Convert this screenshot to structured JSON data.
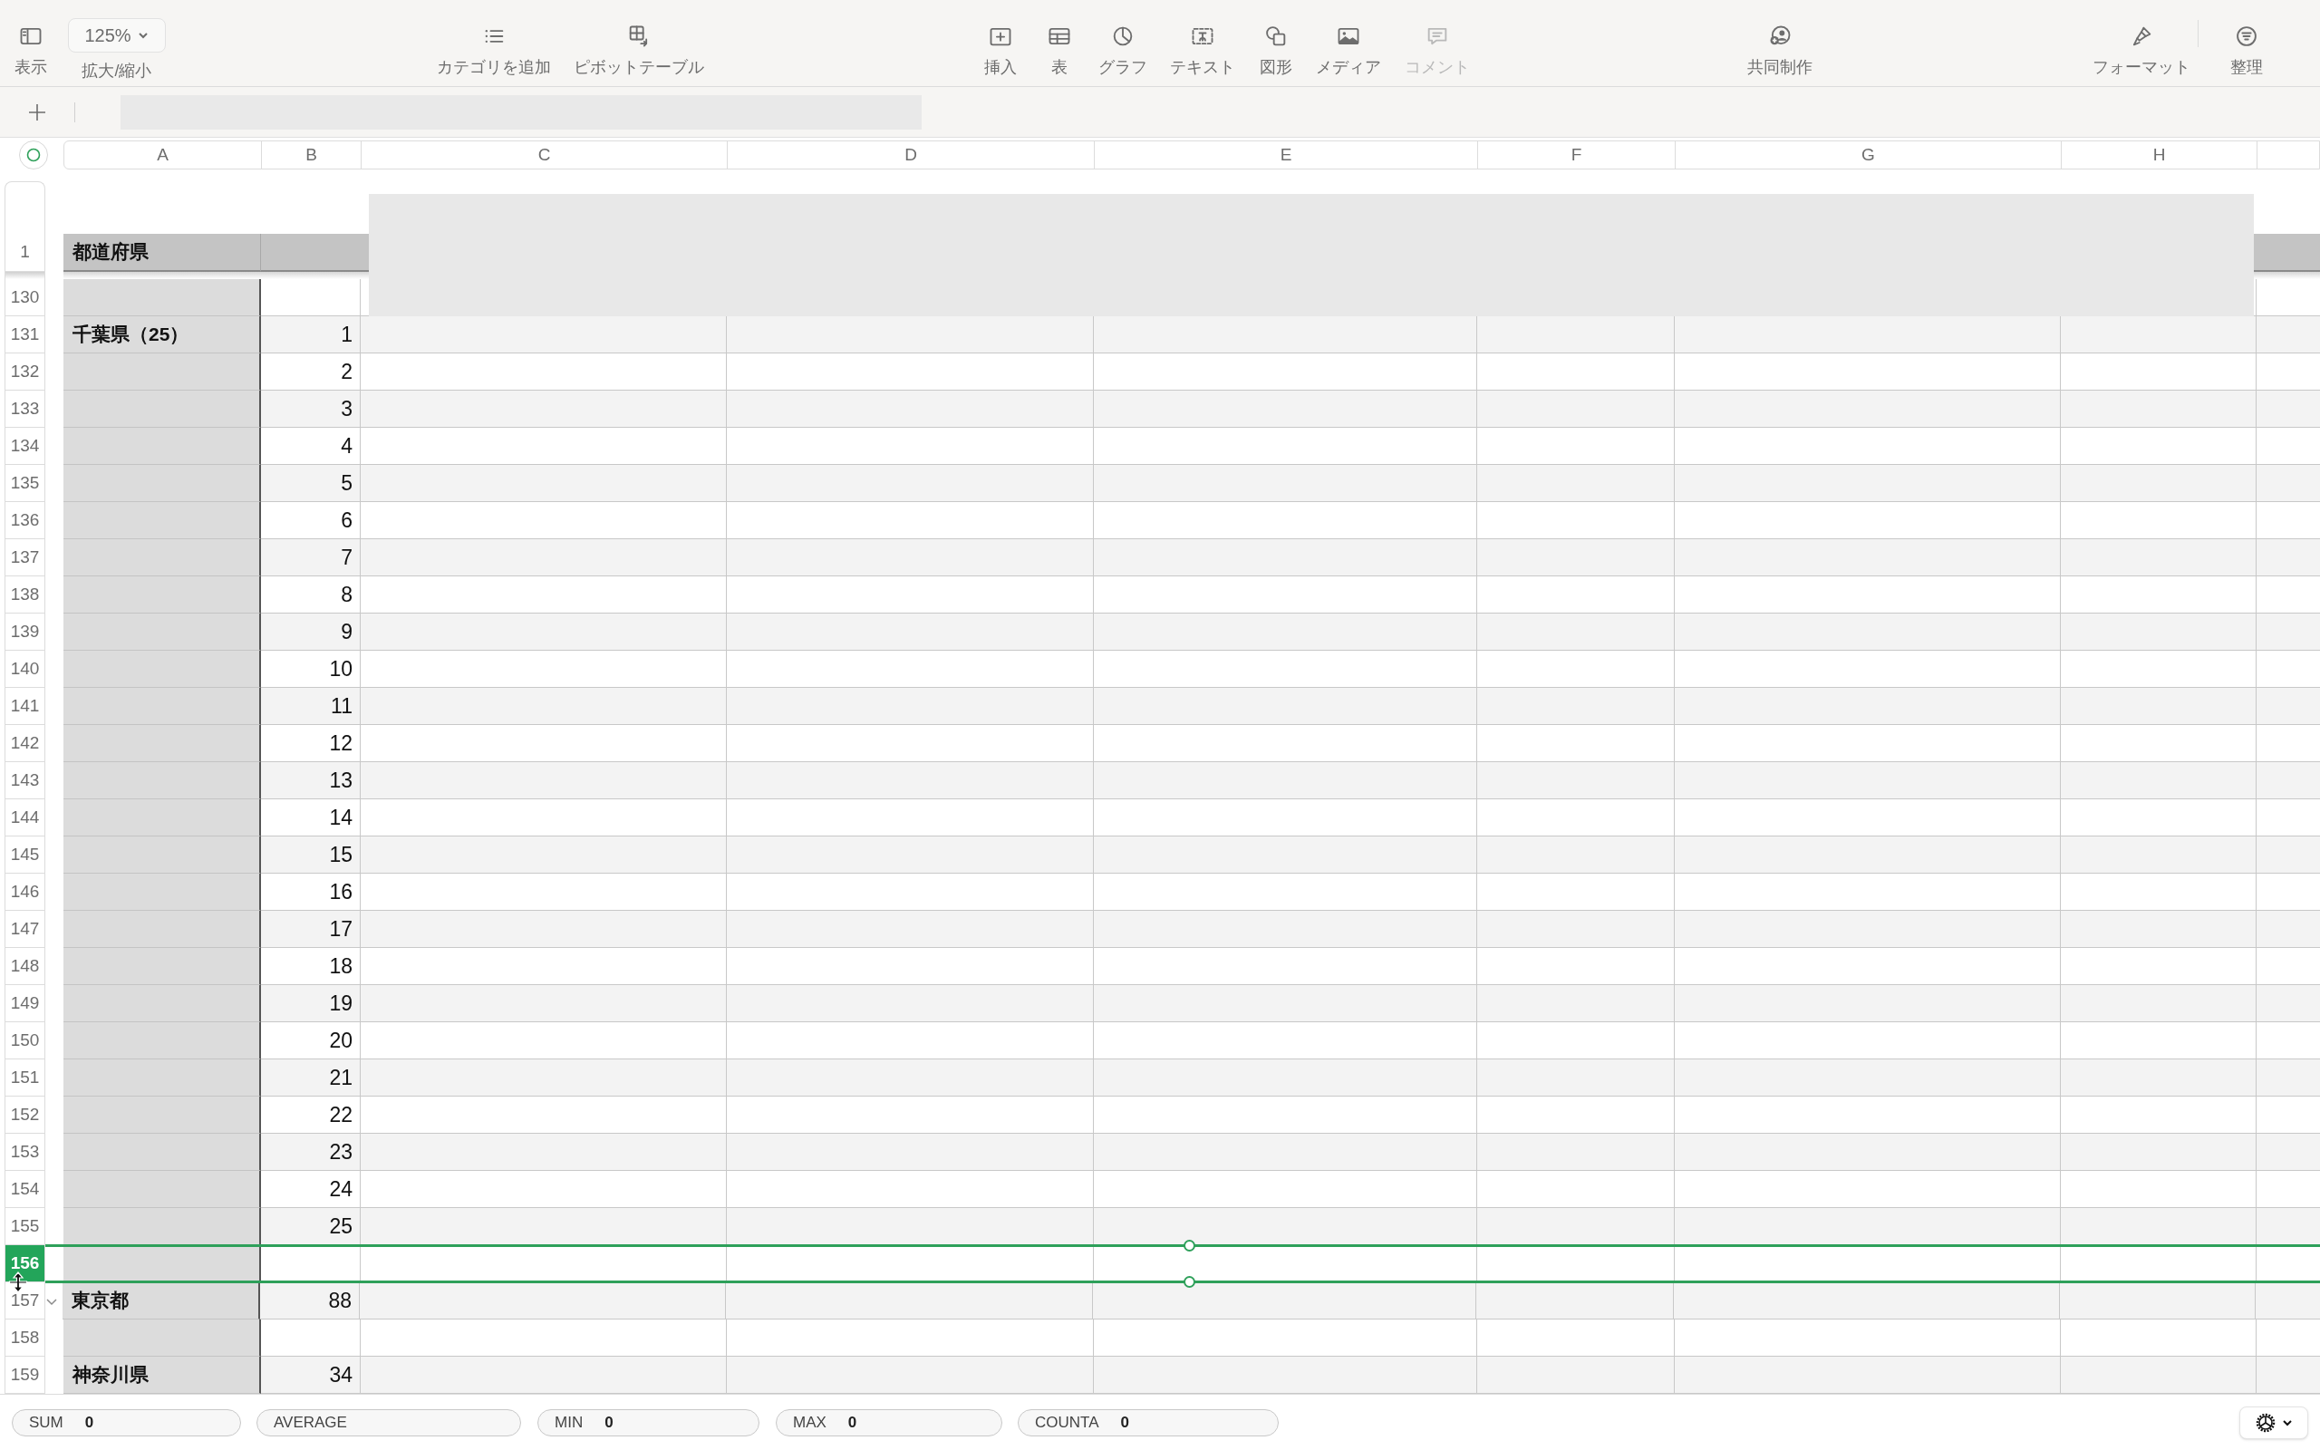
{
  "toolbar": {
    "items": [
      {
        "label": "表示",
        "disabled": false
      },
      {
        "label": "拡大/縮小",
        "value": "125%",
        "disabled": false
      },
      {
        "label": "カテゴリを追加",
        "disabled": false
      },
      {
        "label": "ピボットテーブル",
        "disabled": false
      },
      {
        "label": "挿入",
        "disabled": false
      },
      {
        "label": "表",
        "disabled": false
      },
      {
        "label": "グラフ",
        "disabled": false
      },
      {
        "label": "テキスト",
        "disabled": false
      },
      {
        "label": "図形",
        "disabled": false
      },
      {
        "label": "メディア",
        "disabled": false
      },
      {
        "label": "コメント",
        "disabled": true
      },
      {
        "label": "共同制作",
        "disabled": false
      },
      {
        "label": "フォーマット",
        "disabled": false
      },
      {
        "label": "整理",
        "disabled": false
      }
    ]
  },
  "columns": [
    "A",
    "B",
    "C",
    "D",
    "E",
    "F",
    "G",
    "H"
  ],
  "header_row": {
    "number": "1",
    "a": "都道府県"
  },
  "rows": [
    {
      "number": "130",
      "selected": false,
      "menu": false
    },
    {
      "number": "131",
      "a": "千葉県（25）",
      "b": "1",
      "selected": false,
      "menu": false
    },
    {
      "number": "132",
      "b": "2",
      "selected": false,
      "menu": false
    },
    {
      "number": "133",
      "b": "3",
      "selected": false,
      "menu": false
    },
    {
      "number": "134",
      "b": "4",
      "selected": false,
      "menu": false
    },
    {
      "number": "135",
      "b": "5",
      "selected": false,
      "menu": false
    },
    {
      "number": "136",
      "b": "6",
      "selected": false,
      "menu": false
    },
    {
      "number": "137",
      "b": "7",
      "selected": false,
      "menu": false
    },
    {
      "number": "138",
      "b": "8",
      "selected": false,
      "menu": false
    },
    {
      "number": "139",
      "b": "9",
      "selected": false,
      "menu": false
    },
    {
      "number": "140",
      "b": "10",
      "selected": false,
      "menu": false
    },
    {
      "number": "141",
      "b": "11",
      "selected": false,
      "menu": false
    },
    {
      "number": "142",
      "b": "12",
      "selected": false,
      "menu": false
    },
    {
      "number": "143",
      "b": "13",
      "selected": false,
      "menu": false
    },
    {
      "number": "144",
      "b": "14",
      "selected": false,
      "menu": false
    },
    {
      "number": "145",
      "b": "15",
      "selected": false,
      "menu": false
    },
    {
      "number": "146",
      "b": "16",
      "selected": false,
      "menu": false
    },
    {
      "number": "147",
      "b": "17",
      "selected": false,
      "menu": false
    },
    {
      "number": "148",
      "b": "18",
      "selected": false,
      "menu": false
    },
    {
      "number": "149",
      "b": "19",
      "selected": false,
      "menu": false
    },
    {
      "number": "150",
      "b": "20",
      "selected": false,
      "menu": false
    },
    {
      "number": "151",
      "b": "21",
      "selected": false,
      "menu": false
    },
    {
      "number": "152",
      "b": "22",
      "selected": false,
      "menu": false
    },
    {
      "number": "153",
      "b": "23",
      "selected": false,
      "menu": false
    },
    {
      "number": "154",
      "b": "24",
      "selected": false,
      "menu": false
    },
    {
      "number": "155",
      "b": "25",
      "selected": false,
      "menu": false
    },
    {
      "number": "156",
      "selected": true,
      "menu": false
    },
    {
      "number": "157",
      "a": "東京都",
      "b": "88",
      "selected": false,
      "menu": true
    },
    {
      "number": "158",
      "selected": false,
      "menu": false
    },
    {
      "number": "159",
      "a": "神奈川県",
      "b": "34",
      "selected": false,
      "menu": false
    }
  ],
  "status_bar": [
    {
      "label": "SUM",
      "value": "0"
    },
    {
      "label": "AVERAGE"
    },
    {
      "label": "MIN",
      "value": "0"
    },
    {
      "label": "MAX",
      "value": "0"
    },
    {
      "label": "COUNTA",
      "value": "0"
    }
  ]
}
